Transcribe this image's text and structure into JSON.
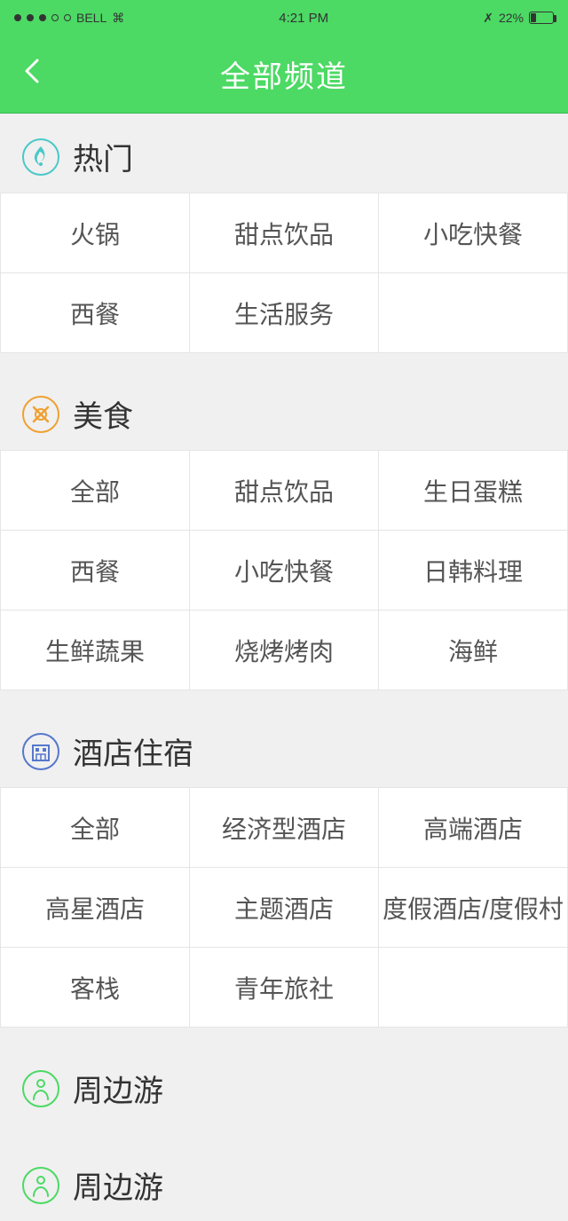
{
  "statusBar": {
    "carrier": "BELL",
    "time": "4:21 PM",
    "battery": "22%"
  },
  "navBar": {
    "title": "全部频道",
    "backLabel": "‹"
  },
  "sections": [
    {
      "id": "hot",
      "title": "热门",
      "iconColor": "#4ac8c8",
      "items": [
        "火锅",
        "甜点饮品",
        "小吃快餐",
        "西餐",
        "生活服务",
        ""
      ]
    },
    {
      "id": "food",
      "title": "美食",
      "iconColor": "#f0a030",
      "items": [
        "全部",
        "甜点饮品",
        "生日蛋糕",
        "西餐",
        "小吃快餐",
        "日韩料理",
        "生鲜蔬果",
        "烧烤烤肉",
        "海鲜"
      ]
    },
    {
      "id": "hotel",
      "title": "酒店住宿",
      "iconColor": "#5577cc",
      "items": [
        "全部",
        "经济型酒店",
        "高端酒店",
        "高星酒店",
        "主题酒店",
        "度假酒店/度假村",
        "客栈",
        "青年旅社",
        ""
      ]
    },
    {
      "id": "nearby",
      "title": "周边游",
      "iconColor": "#4cd964",
      "items": []
    }
  ]
}
